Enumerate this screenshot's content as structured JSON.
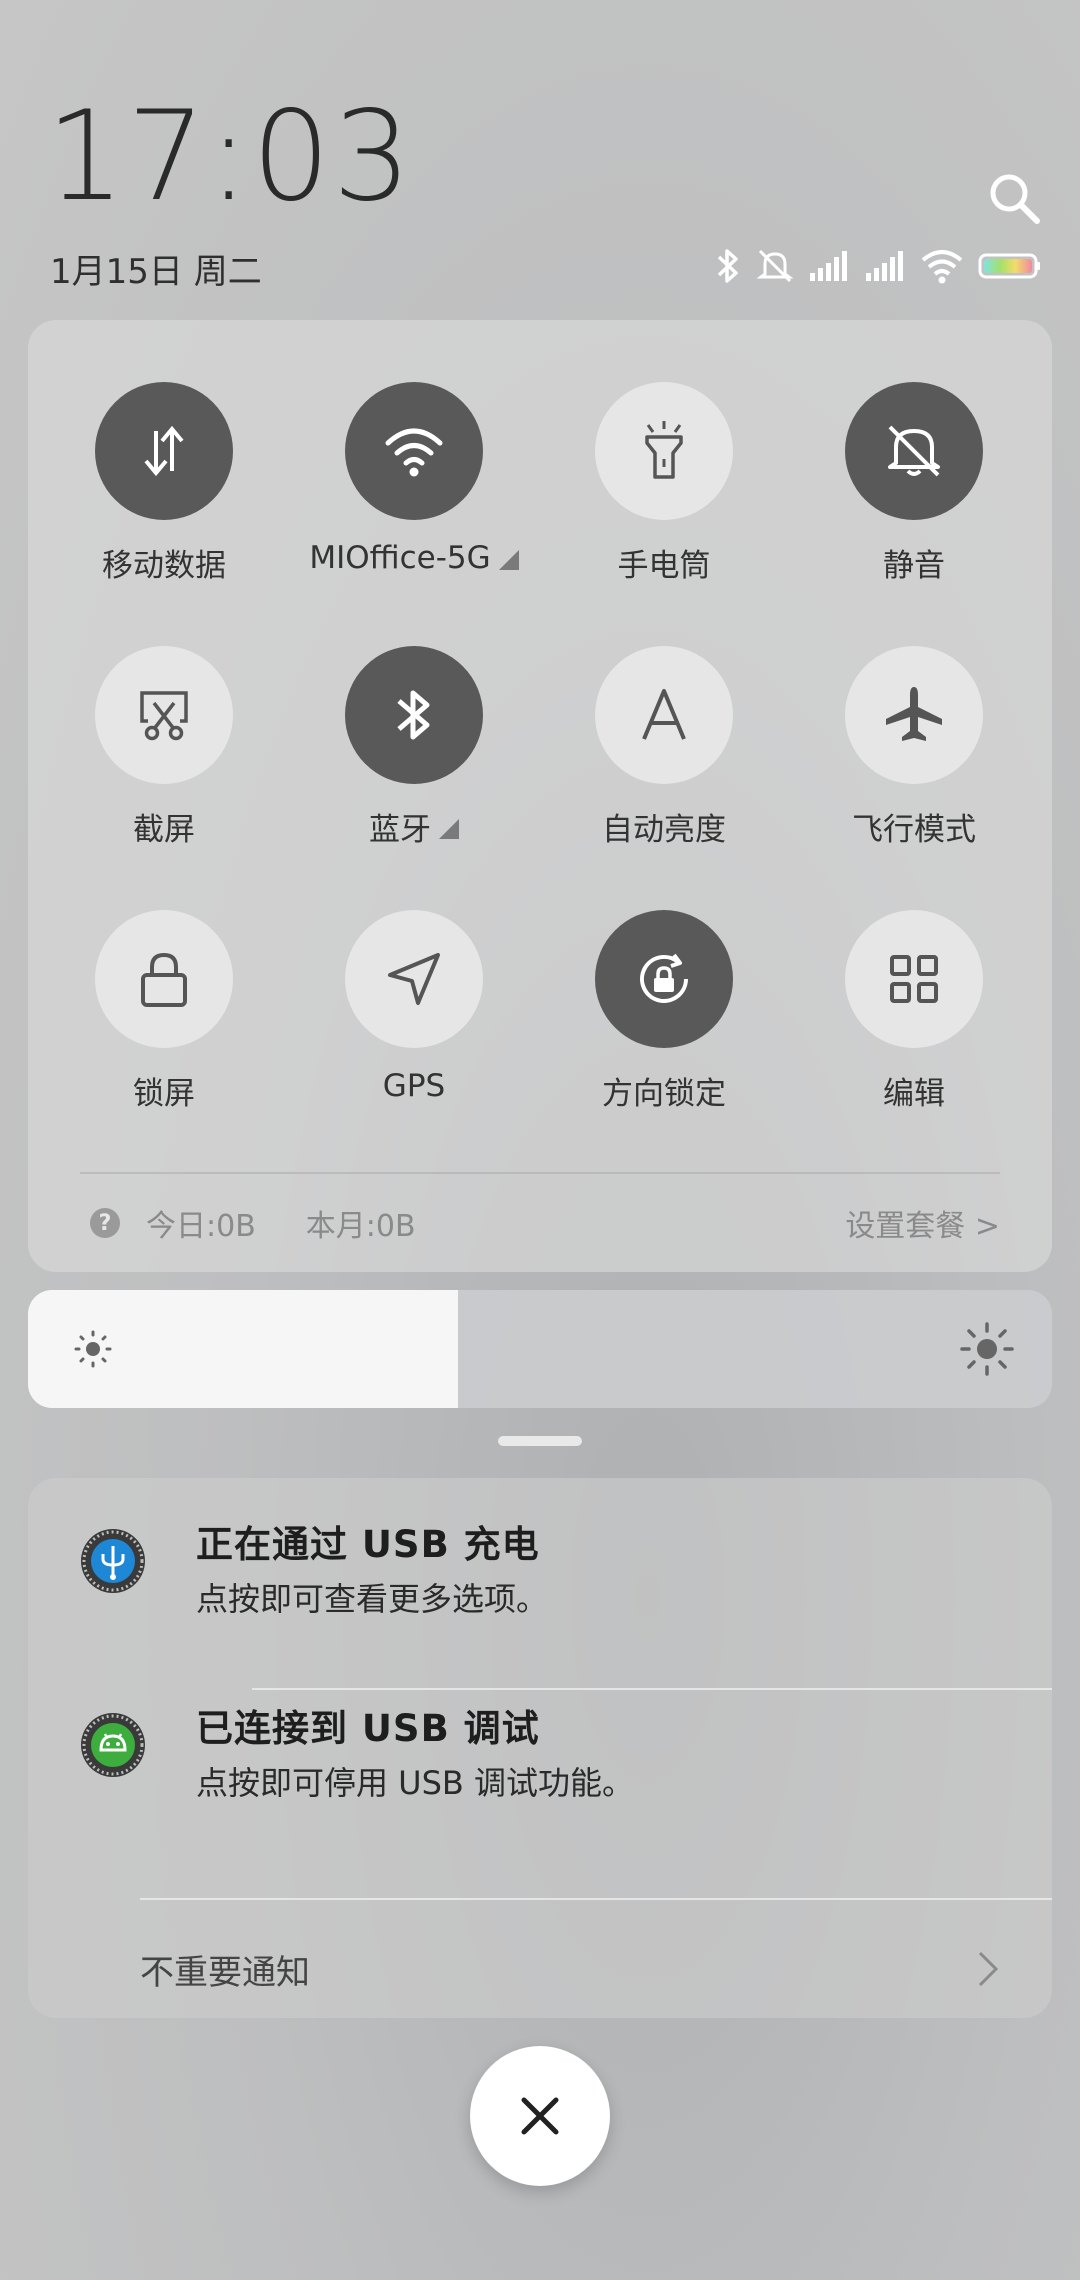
{
  "header": {
    "time": "17:03",
    "date": "1月15日 周二"
  },
  "status_icons": [
    "bluetooth-icon",
    "mute-icon",
    "signal-sim1-icon",
    "signal-sim2-icon",
    "wifi-icon",
    "battery-icon"
  ],
  "tiles": [
    {
      "label": "移动数据",
      "icon": "mobile-data-icon",
      "active": true,
      "has_arrow": false
    },
    {
      "label": "MIOffice-5G",
      "icon": "wifi-icon",
      "active": true,
      "has_arrow": true
    },
    {
      "label": "手电筒",
      "icon": "flashlight-icon",
      "active": false,
      "has_arrow": false
    },
    {
      "label": "静音",
      "icon": "mute-icon",
      "active": true,
      "has_arrow": false
    },
    {
      "label": "截屏",
      "icon": "screenshot-icon",
      "active": false,
      "has_arrow": false
    },
    {
      "label": "蓝牙",
      "icon": "bluetooth-icon",
      "active": true,
      "has_arrow": true
    },
    {
      "label": "自动亮度",
      "icon": "auto-brightness-icon",
      "active": false,
      "has_arrow": false
    },
    {
      "label": "飞行模式",
      "icon": "airplane-icon",
      "active": false,
      "has_arrow": false
    },
    {
      "label": "锁屏",
      "icon": "lock-icon",
      "active": false,
      "has_arrow": false
    },
    {
      "label": "GPS",
      "icon": "gps-icon",
      "active": false,
      "has_arrow": false
    },
    {
      "label": "方向锁定",
      "icon": "rotation-lock-icon",
      "active": true,
      "has_arrow": false
    },
    {
      "label": "编辑",
      "icon": "grid-icon",
      "active": false,
      "has_arrow": false
    }
  ],
  "data_usage": {
    "help_icon": "?",
    "today": "今日:0B",
    "month": "本月:0B",
    "plan_link": "设置套餐 >"
  },
  "brightness": {
    "level": 0.42
  },
  "notifications": [
    {
      "title": "正在通过 USB 充电",
      "text": "点按即可查看更多选项。",
      "icon": "usb-icon",
      "icon_color": "#1e88d6"
    },
    {
      "title": "已连接到 USB 调试",
      "text": "点按即可停用 USB 调试功能。",
      "icon": "android-icon",
      "icon_color": "#3dae3d"
    }
  ],
  "minor_notifications": {
    "label": "不重要通知"
  },
  "colors": {
    "tile_on": "#595959",
    "tile_off": "#e6e6e6"
  }
}
